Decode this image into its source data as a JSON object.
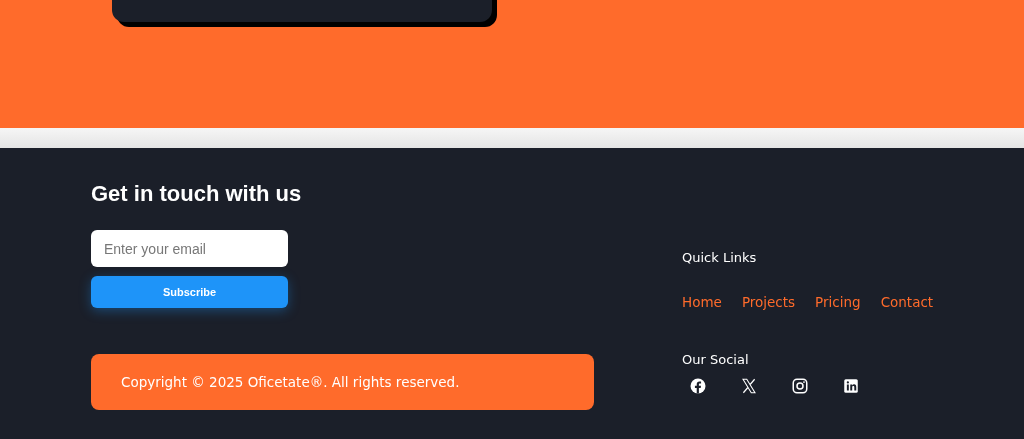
{
  "contact": {
    "heading": "Get in touch with us",
    "email": {
      "placeholder": "Enter your email"
    },
    "button": "Subscribe"
  },
  "copyright": "Copyright © 2025 Oficetate®. All rights reserved.",
  "quick_links": {
    "heading": "Quick Links",
    "links": [
      "Home",
      "Projects",
      "Pricing",
      "Contact"
    ]
  },
  "social": {
    "heading": "Our Social",
    "icons": [
      {
        "kind": "facebook"
      },
      {
        "kind": "x"
      },
      {
        "kind": "instagram"
      },
      {
        "kind": "linkedin"
      }
    ]
  }
}
